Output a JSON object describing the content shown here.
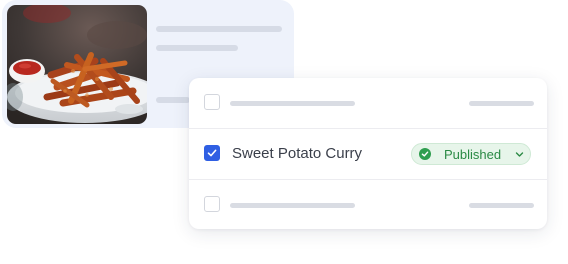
{
  "recipe_list": {
    "rows": [
      {
        "title": "",
        "checked": false
      },
      {
        "title": "Sweet Potato Curry",
        "checked": true,
        "status": "Published"
      },
      {
        "title": "",
        "checked": false
      }
    ]
  },
  "icons": {
    "checkbox_check": "check-icon",
    "status": "check-circle-icon",
    "dropdown": "chevron-down-icon"
  },
  "colors": {
    "accent": "#2f5fe3",
    "status_green": "#2f9e4f",
    "status_bg": "#e7f5ea",
    "card_bg": "#eef2fb"
  }
}
